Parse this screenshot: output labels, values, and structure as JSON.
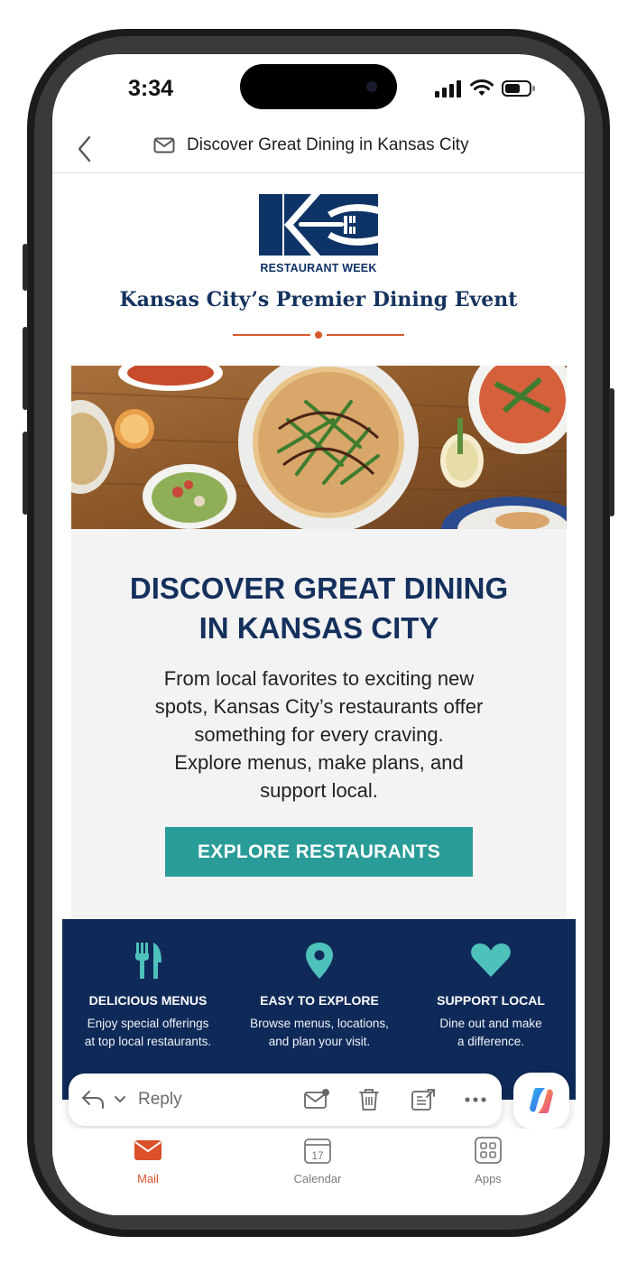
{
  "status_bar": {
    "time": "3:34"
  },
  "header": {
    "subject": "Discover Great Dining in Kansas City"
  },
  "email": {
    "logo_text": "RESTAURANT WEEK",
    "tagline": "Kansas City’s Premier Dining Event",
    "headline_line1": "DISCOVER GREAT DINING",
    "headline_line2": "IN KANSAS CITY",
    "body_lines": [
      "From local favorites to exciting new",
      "spots, Kansas City’s restaurants offer",
      "something for every craving.",
      "Explore menus, make plans, and",
      "support local."
    ],
    "cta_label": "EXPLORE RESTAURANTS",
    "features": [
      {
        "icon": "fork-knife-icon",
        "title": "DELICIOUS MENUS",
        "desc_line1": "Enjoy special offerings",
        "desc_line2": "at top local restaurants."
      },
      {
        "icon": "map-pin-icon",
        "title": "EASY TO EXPLORE",
        "desc_line1": "Browse menus, locations,",
        "desc_line2": "and plan your visit."
      },
      {
        "icon": "heart-icon",
        "title": "SUPPORT LOCAL",
        "desc_line1": "Dine out and make",
        "desc_line2": "a difference."
      }
    ]
  },
  "reply_bar": {
    "reply_label": "Reply"
  },
  "tabs": [
    {
      "label": "Mail",
      "icon": "mail-icon",
      "active": true
    },
    {
      "label": "Calendar",
      "icon": "calendar-icon",
      "date": "17",
      "active": false
    },
    {
      "label": "Apps",
      "icon": "apps-grid-icon",
      "active": false
    }
  ],
  "colors": {
    "navy": "#0f2a58",
    "teal": "#2a9c98",
    "accent_orange": "#d85a2c",
    "mail_active": "#d9502a"
  }
}
